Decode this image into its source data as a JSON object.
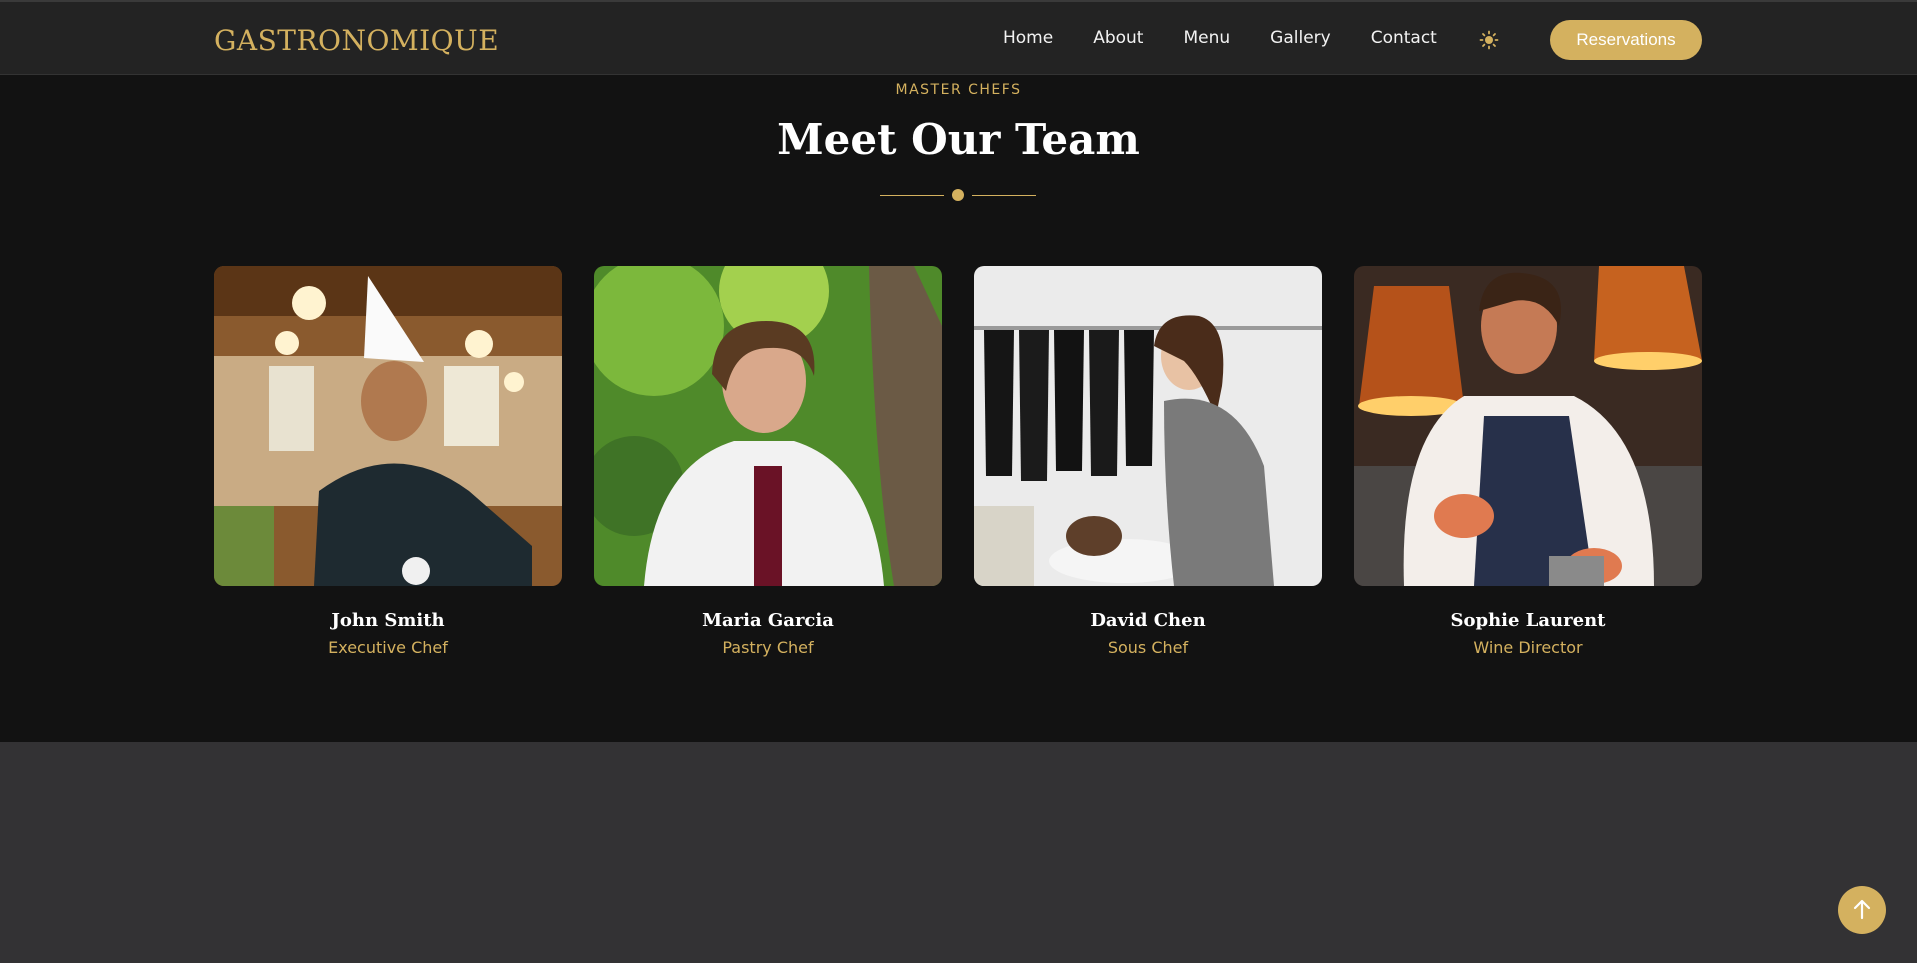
{
  "header": {
    "logo": "GASTRONOMIQUE",
    "nav": [
      {
        "label": "Home"
      },
      {
        "label": "About"
      },
      {
        "label": "Menu"
      },
      {
        "label": "Gallery"
      },
      {
        "label": "Contact"
      }
    ],
    "theme_toggle_icon": "sun-icon",
    "reserve_label": "Reservations"
  },
  "team": {
    "eyebrow": "MASTER CHEFS",
    "title": "Meet Our Team",
    "members": [
      {
        "name": "John Smith",
        "role": "Executive Chef",
        "photo": "chef-portrait"
      },
      {
        "name": "Maria Garcia",
        "role": "Pastry Chef",
        "photo": "chef-portrait"
      },
      {
        "name": "David Chen",
        "role": "Sous Chef",
        "photo": "salon-photo"
      },
      {
        "name": "Sophie Laurent",
        "role": "Wine Director",
        "photo": "kitchen-photo"
      }
    ]
  },
  "back_to_top_icon": "arrow-up-icon",
  "colors": {
    "accent": "#d4b15f",
    "background": "#121212",
    "navbar": "#232323",
    "lower_section": "#333234"
  }
}
